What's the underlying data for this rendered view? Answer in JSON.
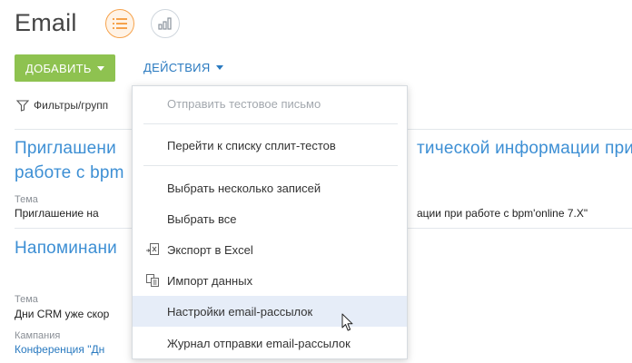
{
  "header": {
    "title": "Email",
    "views": [
      {
        "name": "list-view",
        "icon": "list-icon",
        "active": true
      },
      {
        "name": "analytics-view",
        "icon": "bar-chart-icon",
        "active": false
      }
    ]
  },
  "toolbar": {
    "add_label": "ДОБАВИТЬ",
    "actions_label": "ДЕЙСТВИЯ"
  },
  "filters": {
    "label": "Фильтры/групп"
  },
  "records": [
    {
      "title_line1_left": "Приглашени",
      "title_line1_right": "тической информации при",
      "title_line2": "работе с bpm",
      "subject_label": "Тема",
      "subject_left": "Приглашение на",
      "subject_right": "ации при работе с bpm'online 7.X\""
    },
    {
      "title": "Напоминани",
      "subject_label": "Тема",
      "subject_value": "Дни CRM уже скор",
      "campaign_label": "Кампания",
      "campaign_value": "Конференция \"Дн"
    }
  ],
  "menu": {
    "items": [
      {
        "label": "Отправить тестовое письмо",
        "disabled": true
      },
      {
        "label": "Перейти к списку сплит-тестов"
      },
      {
        "label": "Выбрать несколько записей"
      },
      {
        "label": "Выбрать все"
      },
      {
        "label": "Экспорт в Excel",
        "icon": "excel-export-icon"
      },
      {
        "label": "Импорт данных",
        "icon": "data-import-icon"
      },
      {
        "label": "Настройки email-рассылок",
        "hover": true
      },
      {
        "label": "Журнал отправки email-рассылок"
      }
    ]
  },
  "colors": {
    "accent_green": "#8ec250",
    "link_blue": "#2a7ac0",
    "title_blue": "#3d8fd4",
    "active_orange": "#f6a24b",
    "hover_row": "#e6edf8"
  }
}
